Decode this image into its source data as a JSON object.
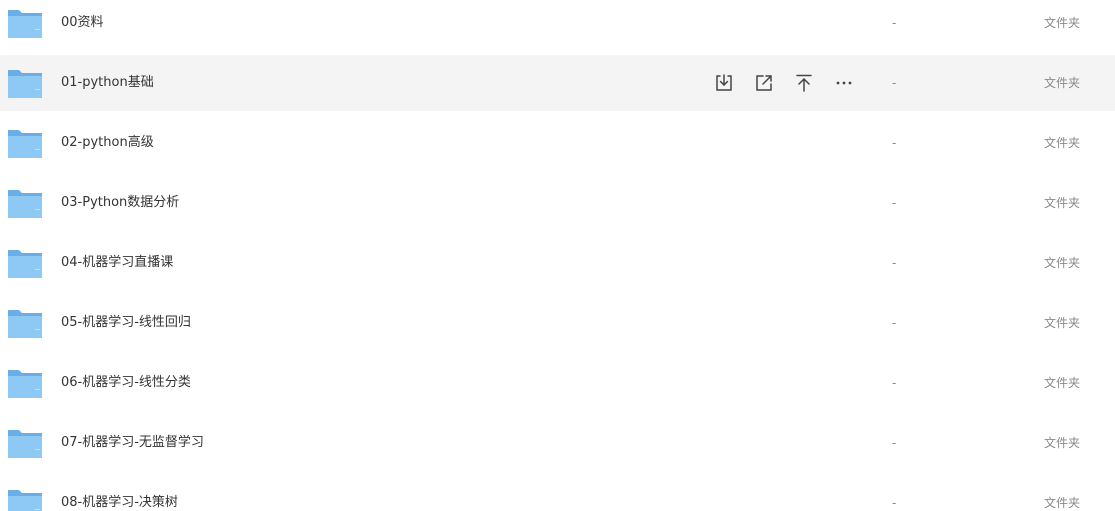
{
  "files": [
    {
      "name": "00资料",
      "size": "-",
      "type": "文件夹"
    },
    {
      "name": "01-python基础",
      "size": "-",
      "type": "文件夹",
      "hovered": true
    },
    {
      "name": "02-python高级",
      "size": "-",
      "type": "文件夹"
    },
    {
      "name": "03-Python数据分析",
      "size": "-",
      "type": "文件夹"
    },
    {
      "name": "04-机器学习直播课",
      "size": "-",
      "type": "文件夹"
    },
    {
      "name": "05-机器学习-线性回归",
      "size": "-",
      "type": "文件夹"
    },
    {
      "name": "06-机器学习-线性分类",
      "size": "-",
      "type": "文件夹"
    },
    {
      "name": "07-机器学习-无监督学习",
      "size": "-",
      "type": "文件夹"
    },
    {
      "name": "08-机器学习-决策树",
      "size": "-",
      "type": "文件夹"
    }
  ],
  "row_actions": [
    {
      "icon": "download-icon"
    },
    {
      "icon": "share-icon"
    },
    {
      "icon": "pin-to-top-icon"
    },
    {
      "icon": "more-icon"
    }
  ],
  "colors": {
    "folder_back": "#6aaee8",
    "folder_front": "#8ec8f4",
    "hover_bg": "#f4f4f4",
    "muted_text": "#8a8a8a"
  }
}
